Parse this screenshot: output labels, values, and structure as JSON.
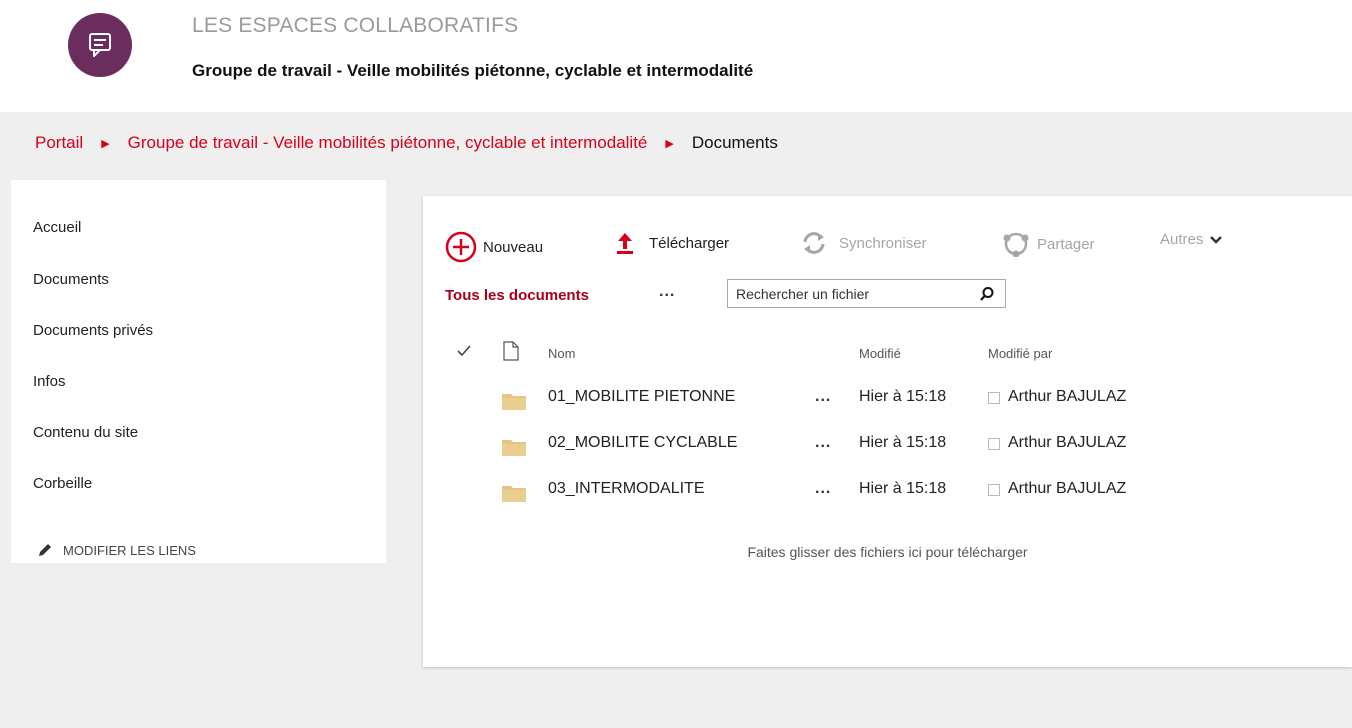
{
  "header": {
    "site_title": "LES ESPACES COLLABORATIFS",
    "site_subtitle": "Groupe de travail - Veille mobilités piétonne, cyclable et intermodalité",
    "logo_icon": "chat-icon",
    "brand_color": "#6b2c5e"
  },
  "breadcrumb": {
    "items": [
      "Portail",
      "Groupe de travail - Veille mobilités piétonne, cyclable et intermodalité",
      "Documents"
    ],
    "separator_icon": "triangle-right-icon",
    "link_color": "#d6001c"
  },
  "sidebar": {
    "items": [
      {
        "label": "Accueil"
      },
      {
        "label": "Documents"
      },
      {
        "label": "Documents privés"
      },
      {
        "label": "Infos"
      },
      {
        "label": "Contenu du site"
      },
      {
        "label": "Corbeille"
      }
    ],
    "edit_links_label": "MODIFIER LES LIENS",
    "edit_icon": "pencil-icon"
  },
  "commandbar": {
    "new_label": "Nouveau",
    "upload_label": "Télécharger",
    "sync_label": "Synchroniser",
    "share_label": "Partager",
    "more_label": "Autres"
  },
  "view": {
    "current": "Tous les documents",
    "more": "...",
    "search_placeholder": "Rechercher un fichier"
  },
  "table": {
    "columns": {
      "name": "Nom",
      "modified": "Modifié",
      "modified_by": "Modifié par"
    },
    "rows": [
      {
        "name": "01_MOBILITE PIETONNE",
        "modified": "Hier à 15:18",
        "modified_by": "Arthur BAJULAZ"
      },
      {
        "name": "02_MOBILITE CYCLABLE",
        "modified": "Hier à 15:18",
        "modified_by": "Arthur BAJULAZ"
      },
      {
        "name": "03_INTERMODALITE",
        "modified": "Hier à 15:18",
        "modified_by": "Arthur BAJULAZ"
      }
    ],
    "row_more": "...",
    "drop_hint": "Faites glisser des fichiers ici pour télécharger"
  }
}
